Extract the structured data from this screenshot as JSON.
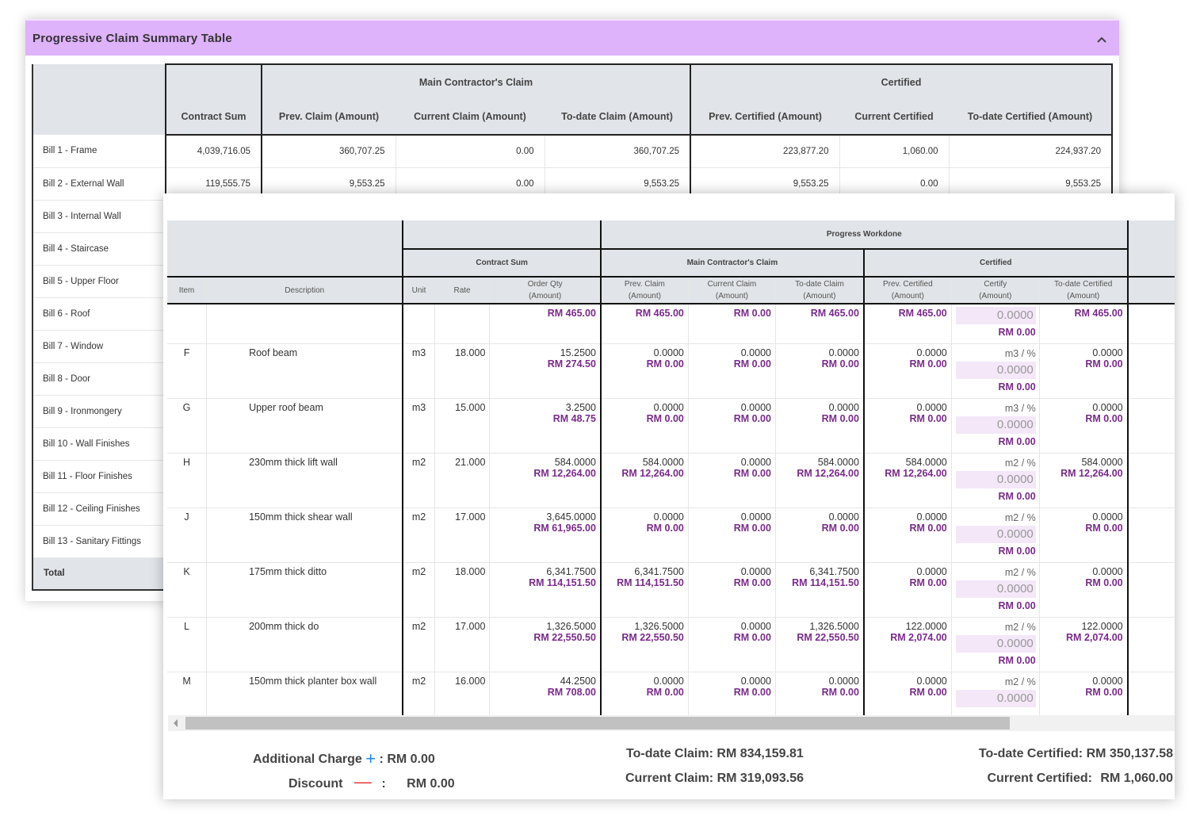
{
  "summary_panel": {
    "title": "Progressive Claim Summary Table",
    "group_headers": {
      "main": "Main Contractor's Claim",
      "certified": "Certified"
    },
    "columns": [
      "Contract Sum",
      "Prev. Claim (Amount)",
      "Current Claim (Amount)",
      "To-date Claim (Amount)",
      "Prev. Certified (Amount)",
      "Current Certified",
      "To-date Certified (Amount)"
    ],
    "bills": [
      {
        "label": "Bill 1 - Frame",
        "values": [
          "4,039,716.05",
          "360,707.25",
          "0.00",
          "360,707.25",
          "223,877.20",
          "1,060.00",
          "224,937.20"
        ]
      },
      {
        "label": "Bill 2 - External Wall",
        "values": [
          "119,555.75",
          "9,553.25",
          "0.00",
          "9,553.25",
          "9,553.25",
          "0.00",
          "9,553.25"
        ]
      },
      {
        "label": "Bill 3 - Internal Wall"
      },
      {
        "label": "Bill 4 - Staircase"
      },
      {
        "label": "Bill 5 - Upper Floor"
      },
      {
        "label": "Bill 6 - Roof"
      },
      {
        "label": "Bill 7 - Window"
      },
      {
        "label": "Bill 8 - Door"
      },
      {
        "label": "Bill 9 - Ironmongery"
      },
      {
        "label": "Bill 10 - Wall Finishes"
      },
      {
        "label": "Bill 11 - Floor Finishes"
      },
      {
        "label": "Bill 12 - Ceiling Finishes"
      },
      {
        "label": "Bill 13 - Sanitary Fittings"
      }
    ],
    "total_label": "Total"
  },
  "detail_panel": {
    "headers": {
      "progress": "Progress Workdone",
      "contract_sum": "Contract Sum",
      "main": "Main Contractor's Claim",
      "certified": "Certified",
      "item": "Item",
      "description": "Description",
      "unit": "Unit",
      "rate": "Rate",
      "order_qty": [
        "Order Qty",
        "(Amount)"
      ],
      "prev_claim": [
        "Prev. Claim",
        "(Amount)"
      ],
      "current_claim": [
        "Current Claim",
        "(Amount)"
      ],
      "todate_claim": [
        "To-date Claim",
        "(Amount)"
      ],
      "prev_certified": [
        "Prev. Certified",
        "(Amount)"
      ],
      "certify": [
        "Certify",
        "(Amount)"
      ],
      "todate_certified": [
        "To-date Certified",
        "(Amount)"
      ]
    },
    "first_row": {
      "order": "RM 465.00",
      "prev": "RM 465.00",
      "cur": "RM 0.00",
      "todate": "RM 465.00",
      "prevcert": "RM 465.00",
      "certify_input": "0.0000",
      "certify_amt": "RM 0.00",
      "todatecert": "RM 465.00"
    },
    "rows": [
      {
        "item": "F",
        "desc": "Roof beam",
        "unit": "m3",
        "rate": "18.000",
        "order_qty": "15.2500",
        "order_amt": "RM 274.50",
        "prev_qty": "0.0000",
        "prev_amt": "RM 0.00",
        "cur_qty": "0.0000",
        "cur_amt": "RM 0.00",
        "todate_qty": "0.0000",
        "todate_amt": "RM 0.00",
        "pc_qty": "0.0000",
        "pc_amt": "RM 0.00",
        "unit_pct": "m3 / %",
        "certify_input": "0.0000",
        "certify_amt": "RM 0.00",
        "tc_qty": "0.0000",
        "tc_amt": "RM 0.00"
      },
      {
        "item": "G",
        "desc": "Upper roof beam",
        "unit": "m3",
        "rate": "15.000",
        "order_qty": "3.2500",
        "order_amt": "RM 48.75",
        "prev_qty": "0.0000",
        "prev_amt": "RM 0.00",
        "cur_qty": "0.0000",
        "cur_amt": "RM 0.00",
        "todate_qty": "0.0000",
        "todate_amt": "RM 0.00",
        "pc_qty": "0.0000",
        "pc_amt": "RM 0.00",
        "unit_pct": "m3 / %",
        "certify_input": "0.0000",
        "certify_amt": "RM 0.00",
        "tc_qty": "0.0000",
        "tc_amt": "RM 0.00"
      },
      {
        "item": "H",
        "desc": "230mm thick lift wall",
        "unit": "m2",
        "rate": "21.000",
        "order_qty": "584.0000",
        "order_amt": "RM 12,264.00",
        "prev_qty": "584.0000",
        "prev_amt": "RM 12,264.00",
        "cur_qty": "0.0000",
        "cur_amt": "RM 0.00",
        "todate_qty": "584.0000",
        "todate_amt": "RM 12,264.00",
        "pc_qty": "584.0000",
        "pc_amt": "RM 12,264.00",
        "unit_pct": "m2 / %",
        "certify_input": "0.0000",
        "certify_amt": "RM 0.00",
        "tc_qty": "584.0000",
        "tc_amt": "RM 12,264.00"
      },
      {
        "item": "J",
        "desc": "150mm thick shear wall",
        "unit": "m2",
        "rate": "17.000",
        "order_qty": "3,645.0000",
        "order_amt": "RM 61,965.00",
        "prev_qty": "0.0000",
        "prev_amt": "RM 0.00",
        "cur_qty": "0.0000",
        "cur_amt": "RM 0.00",
        "todate_qty": "0.0000",
        "todate_amt": "RM 0.00",
        "pc_qty": "0.0000",
        "pc_amt": "RM 0.00",
        "unit_pct": "m2 / %",
        "certify_input": "0.0000",
        "certify_amt": "RM 0.00",
        "tc_qty": "0.0000",
        "tc_amt": "RM 0.00"
      },
      {
        "item": "K",
        "desc": "175mm thick ditto",
        "unit": "m2",
        "rate": "18.000",
        "order_qty": "6,341.7500",
        "order_amt": "RM 114,151.50",
        "prev_qty": "6,341.7500",
        "prev_amt": "RM 114,151.50",
        "cur_qty": "0.0000",
        "cur_amt": "RM 0.00",
        "todate_qty": "6,341.7500",
        "todate_amt": "RM 114,151.50",
        "pc_qty": "0.0000",
        "pc_amt": "RM 0.00",
        "unit_pct": "m2 / %",
        "certify_input": "0.0000",
        "certify_amt": "RM 0.00",
        "tc_qty": "0.0000",
        "tc_amt": "RM 0.00"
      },
      {
        "item": "L",
        "desc": "200mm thick do",
        "unit": "m2",
        "rate": "17.000",
        "order_qty": "1,326.5000",
        "order_amt": "RM 22,550.50",
        "prev_qty": "1,326.5000",
        "prev_amt": "RM 22,550.50",
        "cur_qty": "0.0000",
        "cur_amt": "RM 0.00",
        "todate_qty": "1,326.5000",
        "todate_amt": "RM 22,550.50",
        "pc_qty": "122.0000",
        "pc_amt": "RM 2,074.00",
        "unit_pct": "m2 / %",
        "certify_input": "0.0000",
        "certify_amt": "RM 0.00",
        "tc_qty": "122.0000",
        "tc_amt": "RM 2,074.00"
      },
      {
        "item": "M",
        "desc": "150mm thick planter box wall",
        "unit": "m2",
        "rate": "16.000",
        "order_qty": "44.2500",
        "order_amt": "RM 708.00",
        "prev_qty": "0.0000",
        "prev_amt": "RM 0.00",
        "cur_qty": "0.0000",
        "cur_amt": "RM 0.00",
        "todate_qty": "0.0000",
        "todate_amt": "RM 0.00",
        "pc_qty": "0.0000",
        "pc_amt": "RM 0.00",
        "unit_pct": "m2 / %",
        "certify_input": "0.0000",
        "certify_amt": "",
        "tc_qty": "0.0000",
        "tc_amt": "RM 0.00"
      }
    ],
    "footer": {
      "additional_charge_label": "Additional Charge",
      "additional_charge_value": ": RM 0.00",
      "discount_label": "Discount",
      "discount_colon": ":",
      "discount_value": "RM 0.00",
      "todate_claim_label": "To-date Claim:",
      "todate_claim_value": "RM 834,159.81",
      "current_claim_label": "Current Claim:",
      "current_claim_value": "RM 319,093.56",
      "todate_certified_label": "To-date Certified:",
      "todate_certified_value": "RM 350,137.58",
      "current_certified_label": "Current Certified:",
      "current_certified_value": "RM 1,060.00"
    }
  }
}
